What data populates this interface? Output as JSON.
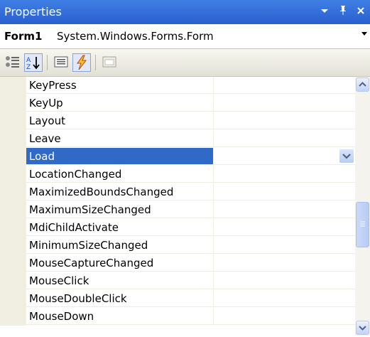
{
  "window": {
    "title": "Properties",
    "pin_icon": "pin-icon",
    "close_icon": "close-icon",
    "menu_icon": "chevron-down-icon"
  },
  "object_selector": {
    "name": "Form1",
    "type": "System.Windows.Forms.Form"
  },
  "toolbar": {
    "buttons": [
      "categorized",
      "alphabetical",
      "properties",
      "events",
      "property-pages"
    ],
    "pressed": [
      "alphabetical",
      "events"
    ]
  },
  "events": [
    "KeyPress",
    "KeyUp",
    "Layout",
    "Leave",
    "Load",
    "LocationChanged",
    "MaximizedBoundsChanged",
    "MaximumSizeChanged",
    "MdiChildActivate",
    "MinimumSizeChanged",
    "MouseCaptureChanged",
    "MouseClick",
    "MouseDoubleClick",
    "MouseDown"
  ],
  "selected_event": "Load",
  "colors": {
    "titlebar": "#2e64d4",
    "selection": "#3169c6",
    "gutter": "#f1efe2"
  }
}
